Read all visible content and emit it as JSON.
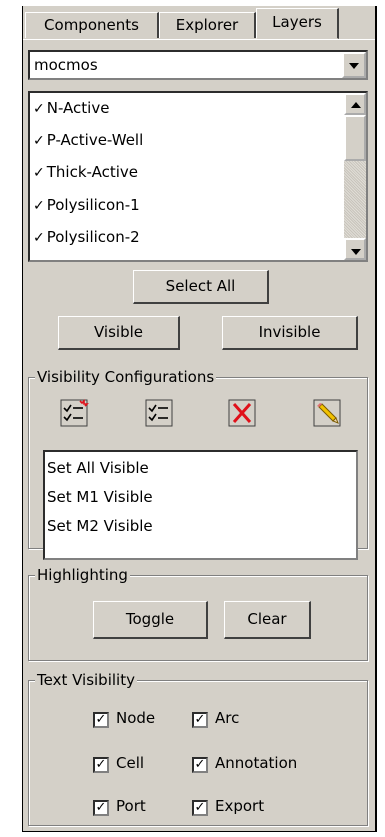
{
  "tabs": {
    "components": "Components",
    "explorer": "Explorer",
    "layers": "Layers"
  },
  "technology": {
    "selected": "mocmos"
  },
  "layers": [
    {
      "label": "N-Active",
      "visible": true
    },
    {
      "label": "P-Active-Well",
      "visible": true
    },
    {
      "label": "Thick-Active",
      "visible": true
    },
    {
      "label": "Polysilicon-1",
      "visible": true
    },
    {
      "label": "Polysilicon-2",
      "visible": true
    }
  ],
  "check_glyph": "✓",
  "buttons": {
    "select_all": "Select All",
    "visible": "Visible",
    "invisible": "Invisible"
  },
  "visibility_configs": {
    "title": "Visibility Configurations",
    "icons": [
      "new-config-icon",
      "edit-list-icon",
      "delete-icon",
      "rename-pencil-icon"
    ],
    "items": [
      "Set All Visible",
      "Set M1 Visible",
      "Set M2 Visible"
    ]
  },
  "highlighting": {
    "title": "Highlighting",
    "toggle": "Toggle",
    "clear": "Clear"
  },
  "text_visibility": {
    "title": "Text Visibility",
    "options": [
      {
        "label": "Node",
        "checked": true
      },
      {
        "label": "Arc",
        "checked": true
      },
      {
        "label": "Cell",
        "checked": true
      },
      {
        "label": "Annotation",
        "checked": true
      },
      {
        "label": "Port",
        "checked": true
      },
      {
        "label": "Export",
        "checked": true
      }
    ]
  },
  "colors": {
    "panel": "#d4d0c8",
    "delete_red": "#e0101a"
  }
}
